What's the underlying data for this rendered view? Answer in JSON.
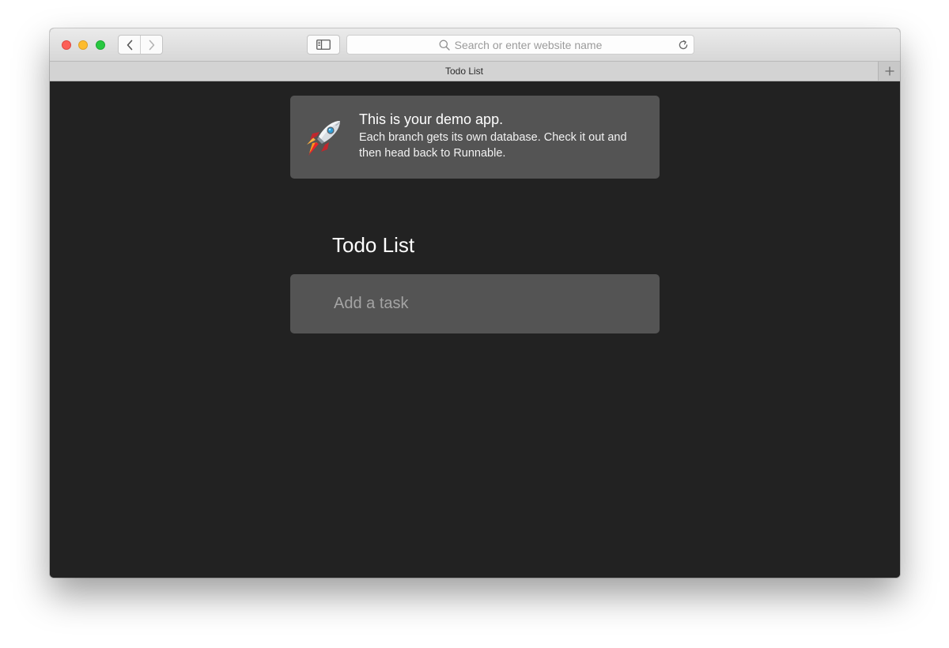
{
  "browser": {
    "url_placeholder": "Search or enter website name",
    "tab_title": "Todo List",
    "icons": {
      "back": "chevron-left-icon",
      "forward": "chevron-right-icon",
      "sidebar": "sidebar-icon",
      "search": "search-icon",
      "reload": "reload-icon",
      "new_tab": "plus-icon"
    },
    "traffic_light_colors": {
      "close": "#fc5f57",
      "minimize": "#fdbc2e",
      "maximize": "#28c840"
    }
  },
  "banner": {
    "icon": "rocket-icon",
    "title": "This is your demo app.",
    "text": "Each branch gets its own database. Check it out and then head back to Runnable."
  },
  "app": {
    "title": "Todo List",
    "input": {
      "placeholder": "Add a task",
      "value": ""
    }
  },
  "colors": {
    "page_background": "#222222",
    "card_background": "#545454",
    "text": "#ffffff"
  }
}
